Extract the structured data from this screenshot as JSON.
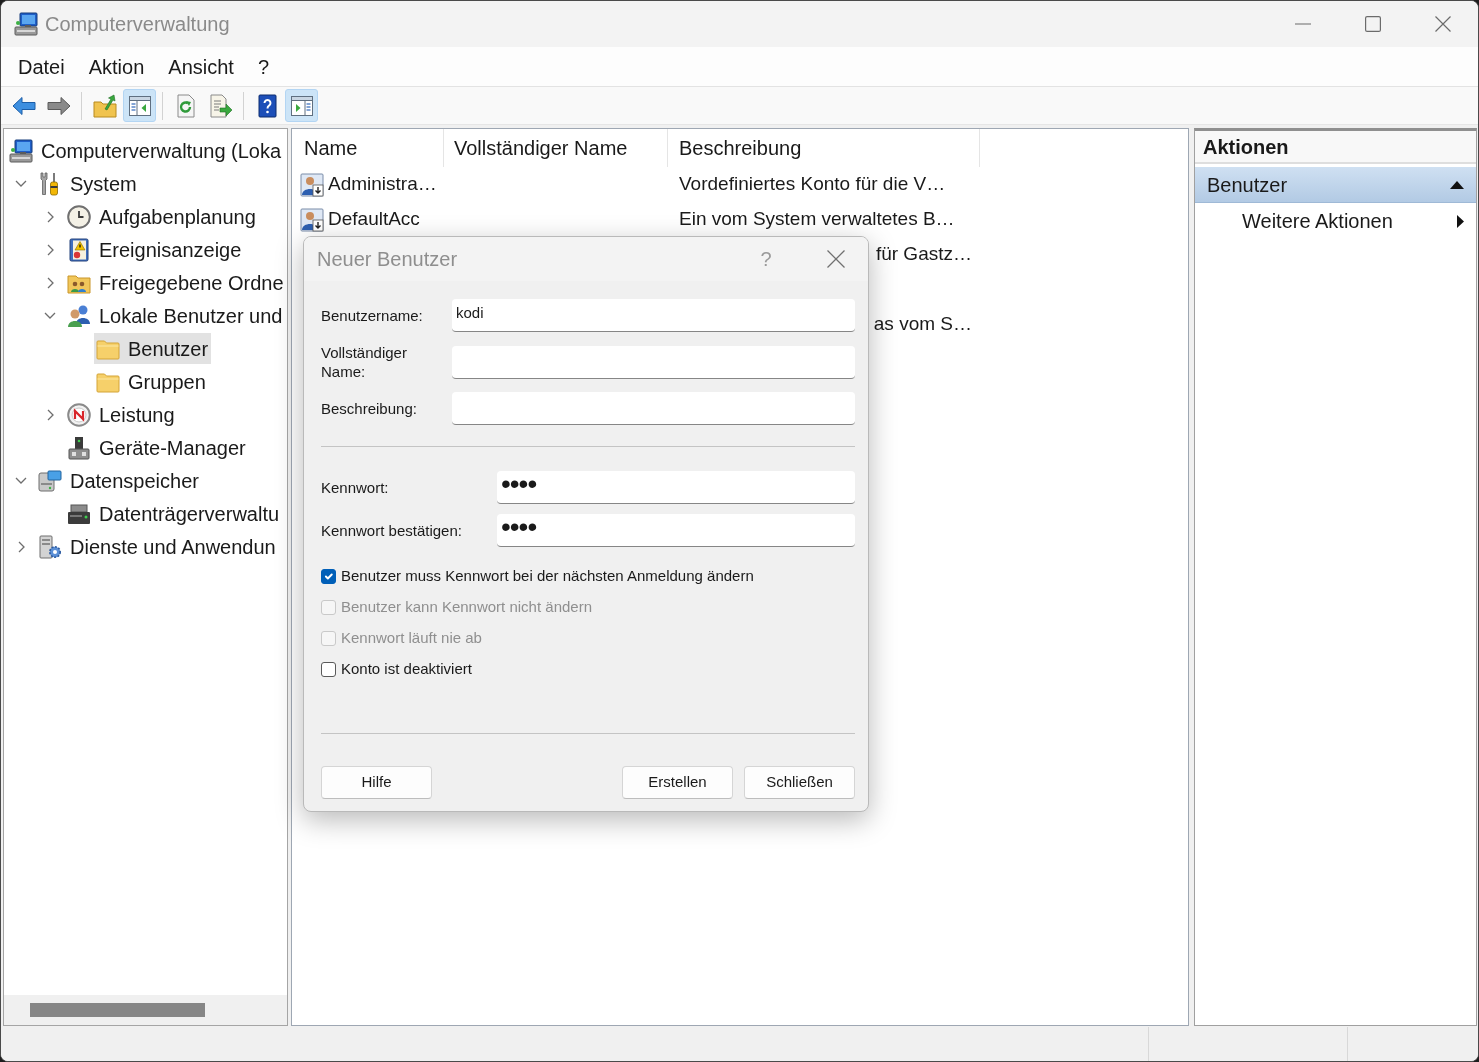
{
  "window": {
    "title": "Computerverwaltung"
  },
  "menu": [
    "Datei",
    "Aktion",
    "Ansicht",
    "?"
  ],
  "toolbar": [
    [
      {
        "kind": "back",
        "pressed": false,
        "disabled": false
      },
      {
        "kind": "forward",
        "pressed": false,
        "disabled": true
      }
    ],
    [
      {
        "kind": "up",
        "pressed": false,
        "disabled": false
      },
      {
        "kind": "tree",
        "pressed": true,
        "disabled": false
      }
    ],
    [
      {
        "kind": "refresh",
        "pressed": false,
        "disabled": false
      },
      {
        "kind": "export",
        "pressed": false,
        "disabled": false
      }
    ],
    [
      {
        "kind": "help",
        "pressed": false,
        "disabled": false
      },
      {
        "kind": "actionpane",
        "pressed": true,
        "disabled": false
      }
    ]
  ],
  "tree": [
    {
      "label": "Computerverwaltung (Loka",
      "kind": "computer",
      "selected": false,
      "children": [
        {
          "label": "System",
          "kind": "tools",
          "expanded": true,
          "selected": false,
          "children": [
            {
              "label": "Aufgabenplanung",
              "kind": "clock",
              "expanded": false,
              "selected": false
            },
            {
              "label": "Ereignisanzeige",
              "kind": "eventlog",
              "expanded": false,
              "selected": false
            },
            {
              "label": "Freigegebene Ordne",
              "kind": "share",
              "expanded": false,
              "selected": false
            },
            {
              "label": "Lokale Benutzer und",
              "kind": "users",
              "expanded": true,
              "selected": false,
              "children": [
                {
                  "label": "Benutzer",
                  "kind": "folder",
                  "selected": true
                },
                {
                  "label": "Gruppen",
                  "kind": "folder",
                  "selected": false
                }
              ]
            },
            {
              "label": "Leistung",
              "kind": "gauge",
              "expanded": false,
              "selected": false
            },
            {
              "label": "Geräte-Manager",
              "kind": "device",
              "selected": false
            }
          ]
        },
        {
          "label": "Datenspeicher",
          "kind": "storage",
          "expanded": true,
          "selected": false,
          "children": [
            {
              "label": "Datenträgerverwaltu",
              "kind": "disk",
              "selected": false
            }
          ]
        },
        {
          "label": "Dienste und Anwendun",
          "kind": "services",
          "expanded": false,
          "selected": false
        }
      ]
    }
  ],
  "list": {
    "columns": [
      "Name",
      "Vollständiger Name",
      "Beschreibung"
    ],
    "rows": [
      {
        "name": "Administra…",
        "description": "Vordefiniertes Konto für die V…"
      },
      {
        "name": "DefaultAcc",
        "description": "Ein vom System verwaltetes B…"
      },
      {
        "description": "für Gastz…"
      },
      {},
      {
        "description": "as vom S…"
      }
    ]
  },
  "actions": {
    "title": "Aktionen",
    "sections": [
      {
        "label": "Benutzer",
        "expanded": true,
        "items": [
          {
            "label": "Weitere Aktionen",
            "submenu": true
          }
        ]
      }
    ]
  },
  "dialog": {
    "title": "Neuer Benutzer",
    "help": "?",
    "account_fields": [
      {
        "label": "Benutzername:",
        "value": "kodi"
      },
      {
        "label": "Vollständiger Name:"
      },
      {
        "label": "Beschreibung:"
      }
    ],
    "password_fields": [
      {
        "label": "Kennwort:",
        "value": "••••"
      },
      {
        "label": "Kennwort bestätigen:",
        "value": "••••"
      }
    ],
    "options": [
      {
        "label": "Benutzer muss Kennwort bei der nächsten Anmeldung ändern",
        "checked": true,
        "disabled": false
      },
      {
        "label": "Benutzer kann Kennwort nicht ändern",
        "checked": false,
        "disabled": true
      },
      {
        "label": "Kennwort läuft nie ab",
        "checked": false,
        "disabled": true
      },
      {
        "label": "Konto ist deaktiviert",
        "checked": false,
        "disabled": false
      }
    ],
    "buttons": [
      "Hilfe",
      "Erstellen",
      "Schließen"
    ]
  }
}
